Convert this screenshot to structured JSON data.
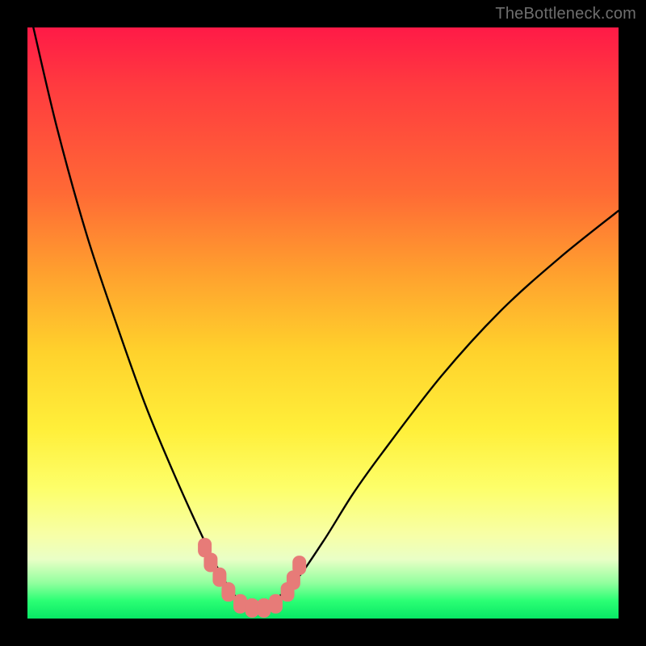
{
  "watermark": {
    "text": "TheBottleneck.com"
  },
  "colors": {
    "background": "#000000",
    "curve_stroke": "#000000",
    "marker_fill": "#e77b78",
    "gradient_stops": [
      "#ff1a47",
      "#ff6a35",
      "#ffd22c",
      "#fdff6a",
      "#e9ffc6",
      "#08e765"
    ]
  },
  "chart_data": {
    "type": "line",
    "title": "",
    "xlabel": "",
    "ylabel": "",
    "xlim": [
      0,
      100
    ],
    "ylim": [
      0,
      100
    ],
    "grid": false,
    "series": [
      {
        "name": "bottleneck-curve",
        "x": [
          1,
          5,
          10,
          15,
          20,
          25,
          30,
          33,
          35,
          37,
          40,
          45,
          50,
          55,
          60,
          70,
          80,
          90,
          100
        ],
        "y": [
          100,
          83,
          65,
          50,
          36,
          24,
          13,
          7,
          4,
          2,
          2,
          6,
          13,
          21,
          28,
          41,
          52,
          61,
          69
        ]
      }
    ],
    "markers": {
      "name": "highlight-points",
      "x": [
        30,
        31,
        32.5,
        34,
        36,
        38,
        40,
        42,
        44,
        45,
        46
      ],
      "y": [
        12,
        9.5,
        7,
        4.5,
        2.5,
        1.8,
        1.8,
        2.5,
        4.5,
        6.5,
        9
      ]
    }
  }
}
